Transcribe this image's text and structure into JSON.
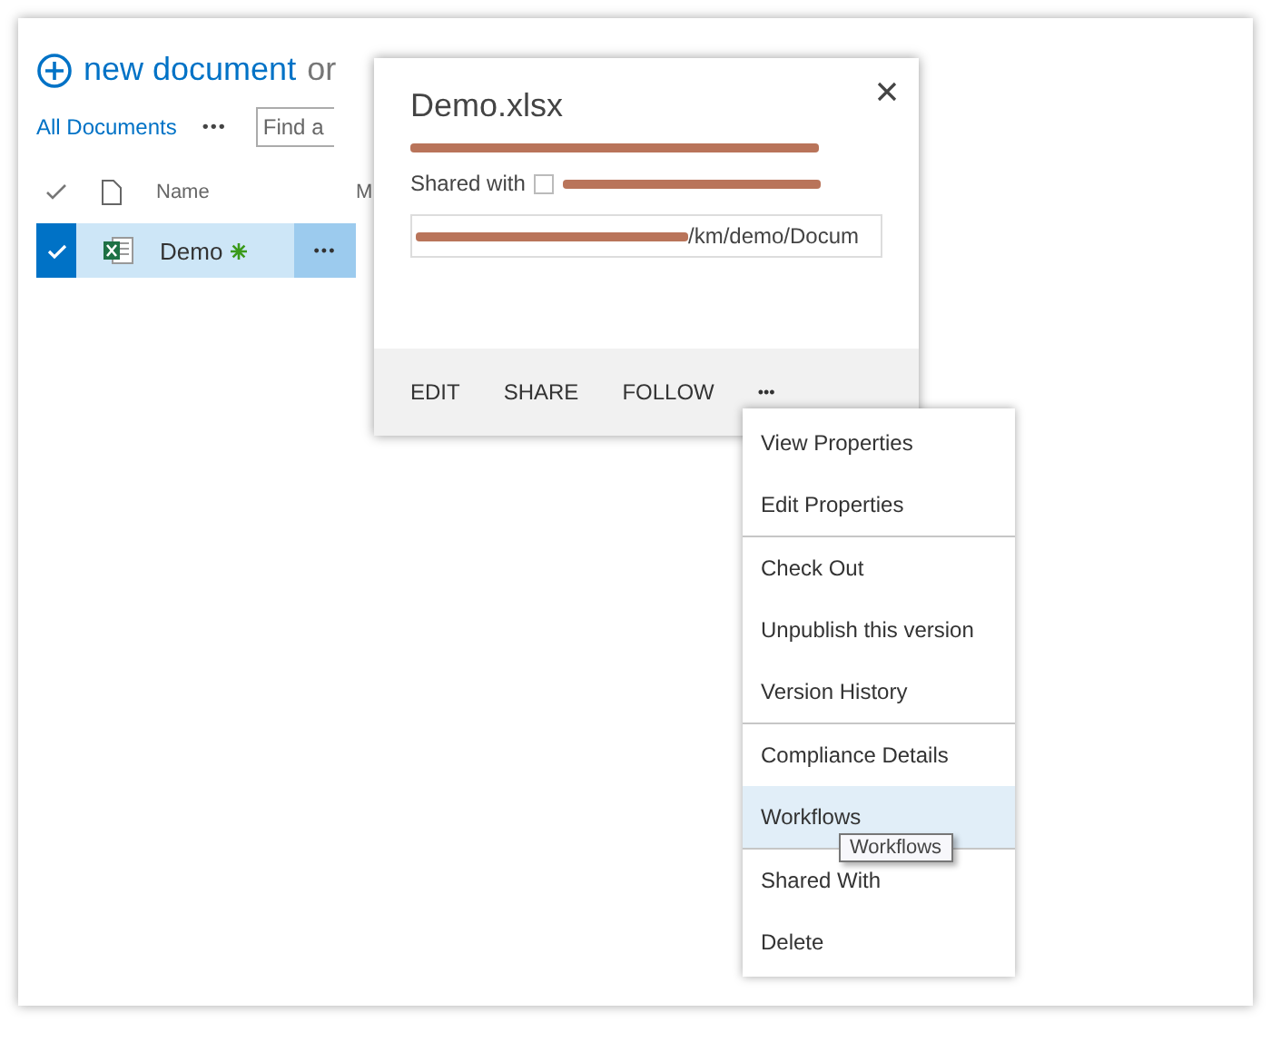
{
  "header": {
    "new_link": "new document",
    "drag_text": "or"
  },
  "views": {
    "current": "All Documents",
    "more": "•••",
    "search_placeholder": "Find a"
  },
  "columns": [
    {
      "label": "Name"
    },
    {
      "label": "M"
    }
  ],
  "rows": [
    {
      "name": "Demo",
      "selected": true,
      "is_new": true,
      "more": "•••"
    }
  ],
  "callout": {
    "title": "Demo.xlsx",
    "shared_label": "Shared with",
    "shared_checked": false,
    "url_visible": "/km/demo/Docum",
    "actions": [
      "EDIT",
      "SHARE",
      "FOLLOW"
    ],
    "more": "•••"
  },
  "menu": {
    "groups": [
      [
        {
          "label": "View Properties",
          "hover": false
        },
        {
          "label": "Edit Properties",
          "hover": false
        }
      ],
      [
        {
          "label": "Check Out",
          "hover": false
        },
        {
          "label": "Unpublish this version",
          "hover": false
        },
        {
          "label": "Version History",
          "hover": false
        }
      ],
      [
        {
          "label": "Compliance Details",
          "hover": false
        },
        {
          "label": "Workflows",
          "hover": true
        }
      ],
      [
        {
          "label": "Shared With",
          "hover": false
        },
        {
          "label": "Delete",
          "hover": false
        }
      ]
    ]
  },
  "tooltip": "Workflows"
}
